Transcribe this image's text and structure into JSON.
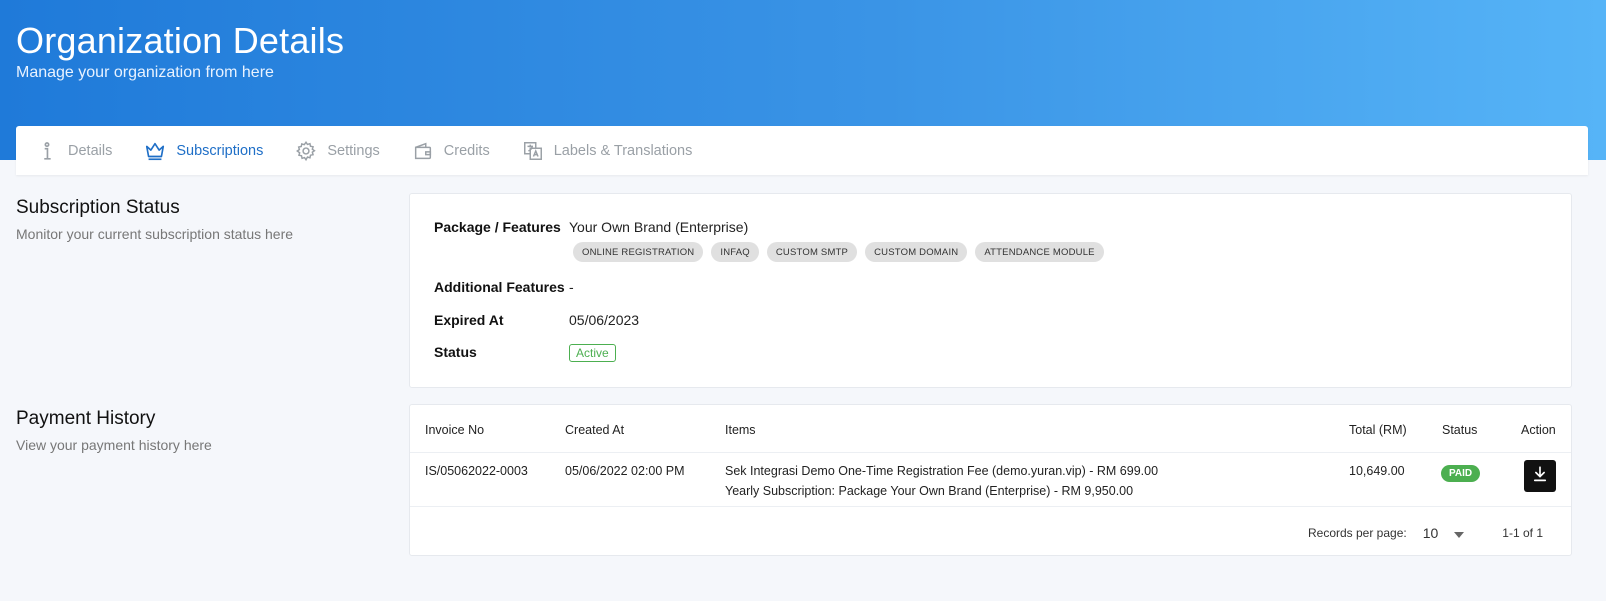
{
  "header": {
    "title": "Organization Details",
    "subtitle": "Manage your organization from here"
  },
  "tabs": [
    {
      "label": "Details",
      "icon": "info-icon",
      "active": false
    },
    {
      "label": "Subscriptions",
      "icon": "crown-icon",
      "active": true
    },
    {
      "label": "Settings",
      "icon": "gear-icon",
      "active": false
    },
    {
      "label": "Credits",
      "icon": "wallet-icon",
      "active": false
    },
    {
      "label": "Labels & Translations",
      "icon": "translate-icon",
      "active": false
    }
  ],
  "subscription": {
    "title": "Subscription Status",
    "subtitle": "Monitor your current subscription status here",
    "package_label": "Package / Features",
    "package_value": "Your Own Brand (Enterprise)",
    "features": [
      "ONLINE REGISTRATION",
      "INFAQ",
      "CUSTOM SMTP",
      "CUSTOM DOMAIN",
      "ATTENDANCE MODULE"
    ],
    "additional_label": "Additional Features",
    "additional_value": "-",
    "expired_label": "Expired At",
    "expired_value": "05/06/2023",
    "status_label": "Status",
    "status_value": "Active"
  },
  "payment": {
    "title": "Payment History",
    "subtitle": "View your payment history here",
    "columns": {
      "invoice": "Invoice No",
      "created": "Created At",
      "items": "Items",
      "total": "Total (RM)",
      "status": "Status",
      "action": "Action"
    },
    "rows": [
      {
        "invoice": "IS/05062022-0003",
        "created": "05/06/2022 02:00 PM",
        "item1": "Sek Integrasi Demo One-Time Registration Fee (demo.yuran.vip) - RM 699.00",
        "item2": "Yearly Subscription: Package Your Own Brand (Enterprise) - RM 9,950.00",
        "total": "10,649.00",
        "status": "PAID"
      }
    ],
    "footer": {
      "records_label": "Records per page:",
      "records_value": "10",
      "range": "1-1 of 1"
    }
  },
  "colors": {
    "accent": "#1f6fc7",
    "success": "#4caf50",
    "header_start": "#1f7ad9",
    "header_end": "#56b4f7"
  }
}
